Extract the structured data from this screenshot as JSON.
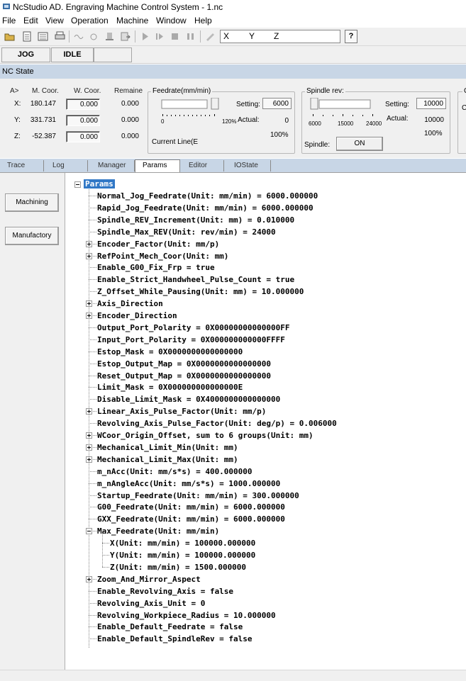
{
  "window": {
    "title": "NcStudio AD. Engraving Machine Control System  - 1.nc"
  },
  "menu": [
    "File",
    "Edit",
    "View",
    "Operation",
    "Machine",
    "Window",
    "Help"
  ],
  "toolbar": {
    "coord_x": "X",
    "coord_y": "Y",
    "coord_z": "Z",
    "help_label": "?"
  },
  "status": {
    "mode": "JOG",
    "state": "IDLE"
  },
  "ncstate": {
    "header": "NC State",
    "cols": {
      "axis": "A>",
      "mcoor": "M. Coor.",
      "wcoor": "W. Coor.",
      "remain": "Remaine"
    },
    "axes": [
      {
        "label": "X:",
        "mcoor": "180.147",
        "wcoor": "0.000",
        "remain": "0.000"
      },
      {
        "label": "Y:",
        "mcoor": "331.731",
        "wcoor": "0.000",
        "remain": "0.000"
      },
      {
        "label": "Z:",
        "mcoor": "-52.387",
        "wcoor": "0.000",
        "remain": "0.000"
      }
    ],
    "feedrate": {
      "title": "Feedrate(mm/min)",
      "setting_label": "Setting:",
      "setting": "6000",
      "actual_label": "Actual:",
      "actual": "0",
      "percent": "100%",
      "scale_min": "0",
      "scale_max": "120%",
      "current_line": "Current Line(E"
    },
    "spindle": {
      "title": "Spindle rev:",
      "setting_label": "Setting:",
      "setting": "10000",
      "actual_label": "Actual:",
      "actual": "10000",
      "percent": "100%",
      "ticks": [
        "6000",
        "15000",
        "24000"
      ],
      "spindle_label": "Spindle:",
      "button": "ON"
    },
    "right_cut": {
      "a": "C",
      "b": "C"
    }
  },
  "tabs": [
    {
      "label": "Trace",
      "active": false
    },
    {
      "label": "Log",
      "active": false
    },
    {
      "label": "Manager",
      "active": false
    },
    {
      "label": "Params",
      "active": true
    },
    {
      "label": "Editor",
      "active": false
    },
    {
      "label": "IOState",
      "active": false
    }
  ],
  "side_buttons": [
    "Machining",
    "Manufactory"
  ],
  "params": {
    "root": "Params",
    "items": [
      {
        "text": "Normal_Jog_Feedrate(Unit: mm/min) = 6000.000000",
        "expandable": false,
        "level": 1
      },
      {
        "text": "Rapid_Jog_Feedrate(Unit: mm/min) = 6000.000000",
        "expandable": false,
        "level": 1
      },
      {
        "text": "Spindle_REV_Increment(Unit: mm) = 0.010000",
        "expandable": false,
        "level": 1
      },
      {
        "text": "Spindle_Max_REV(Unit: rev/min) = 24000",
        "expandable": false,
        "level": 1
      },
      {
        "text": "Encoder_Factor(Unit: mm/p)",
        "expandable": true,
        "level": 1
      },
      {
        "text": "RefPoint_Mech_Coor(Unit: mm)",
        "expandable": true,
        "level": 1
      },
      {
        "text": "Enable_G00_Fix_Frp = true",
        "expandable": false,
        "level": 1
      },
      {
        "text": "Enable_Strict_Handwheel_Pulse_Count = true",
        "expandable": false,
        "level": 1
      },
      {
        "text": "Z_Offset_While_Pausing(Unit: mm) = 10.000000",
        "expandable": false,
        "level": 1
      },
      {
        "text": "Axis_Direction",
        "expandable": true,
        "level": 1
      },
      {
        "text": "Encoder_Direction",
        "expandable": true,
        "level": 1
      },
      {
        "text": "Output_Port_Polarity = 0X00000000000000FF",
        "expandable": false,
        "level": 1
      },
      {
        "text": "Input_Port_Polarity = 0X000000000000FFFF",
        "expandable": false,
        "level": 1
      },
      {
        "text": "Estop_Mask = 0X0000000000000000",
        "expandable": false,
        "level": 1
      },
      {
        "text": "Estop_Output_Map = 0X0000000000000000",
        "expandable": false,
        "level": 1
      },
      {
        "text": "Reset_Output_Map = 0X0000000000000000",
        "expandable": false,
        "level": 1
      },
      {
        "text": "Limit_Mask = 0X000000000000000E",
        "expandable": false,
        "level": 1
      },
      {
        "text": "Disable_Limit_Mask = 0X4000000000000000",
        "expandable": false,
        "level": 1
      },
      {
        "text": "Linear_Axis_Pulse_Factor(Unit: mm/p)",
        "expandable": true,
        "level": 1
      },
      {
        "text": "Revolving_Axis_Pulse_Factor(Unit: deg/p) = 0.006000",
        "expandable": false,
        "level": 1
      },
      {
        "text": "WCoor_Origin_Offset, sum to 6 groups(Unit: mm)",
        "expandable": true,
        "level": 1
      },
      {
        "text": "Mechanical_Limit_Min(Unit: mm)",
        "expandable": true,
        "level": 1
      },
      {
        "text": "Mechanical_Limit_Max(Unit: mm)",
        "expandable": true,
        "level": 1
      },
      {
        "text": "m_nAcc(Unit: mm/s*s) = 400.000000",
        "expandable": false,
        "level": 1
      },
      {
        "text": "m_nAngleAcc(Unit: mm/s*s) = 1000.000000",
        "expandable": false,
        "level": 1
      },
      {
        "text": "Startup_Feedrate(Unit: mm/min) = 300.000000",
        "expandable": false,
        "level": 1
      },
      {
        "text": "G00_Feedrate(Unit: mm/min) = 6000.000000",
        "expandable": false,
        "level": 1
      },
      {
        "text": "GXX_Feedrate(Unit: mm/min) = 6000.000000",
        "expandable": false,
        "level": 1
      },
      {
        "text": "Max_Feedrate(Unit: mm/min)",
        "expandable": true,
        "expanded": true,
        "level": 1
      },
      {
        "text": "X(Unit: mm/min) = 100000.000000",
        "expandable": false,
        "level": 2
      },
      {
        "text": "Y(Unit: mm/min) = 100000.000000",
        "expandable": false,
        "level": 2
      },
      {
        "text": "Z(Unit: mm/min) = 1500.000000",
        "expandable": false,
        "level": 2
      },
      {
        "text": "Zoom_And_Mirror_Aspect",
        "expandable": true,
        "level": 1
      },
      {
        "text": "Enable_Revolving_Axis = false",
        "expandable": false,
        "level": 1
      },
      {
        "text": "Revolving_Axis_Unit = 0",
        "expandable": false,
        "level": 1
      },
      {
        "text": "Revolving_Workpiece_Radius = 10.000000",
        "expandable": false,
        "level": 1
      },
      {
        "text": "Enable_Default_Feedrate = false",
        "expandable": false,
        "level": 1
      },
      {
        "text": "Enable_Default_SpindleRev = false",
        "expandable": false,
        "level": 1
      }
    ]
  }
}
